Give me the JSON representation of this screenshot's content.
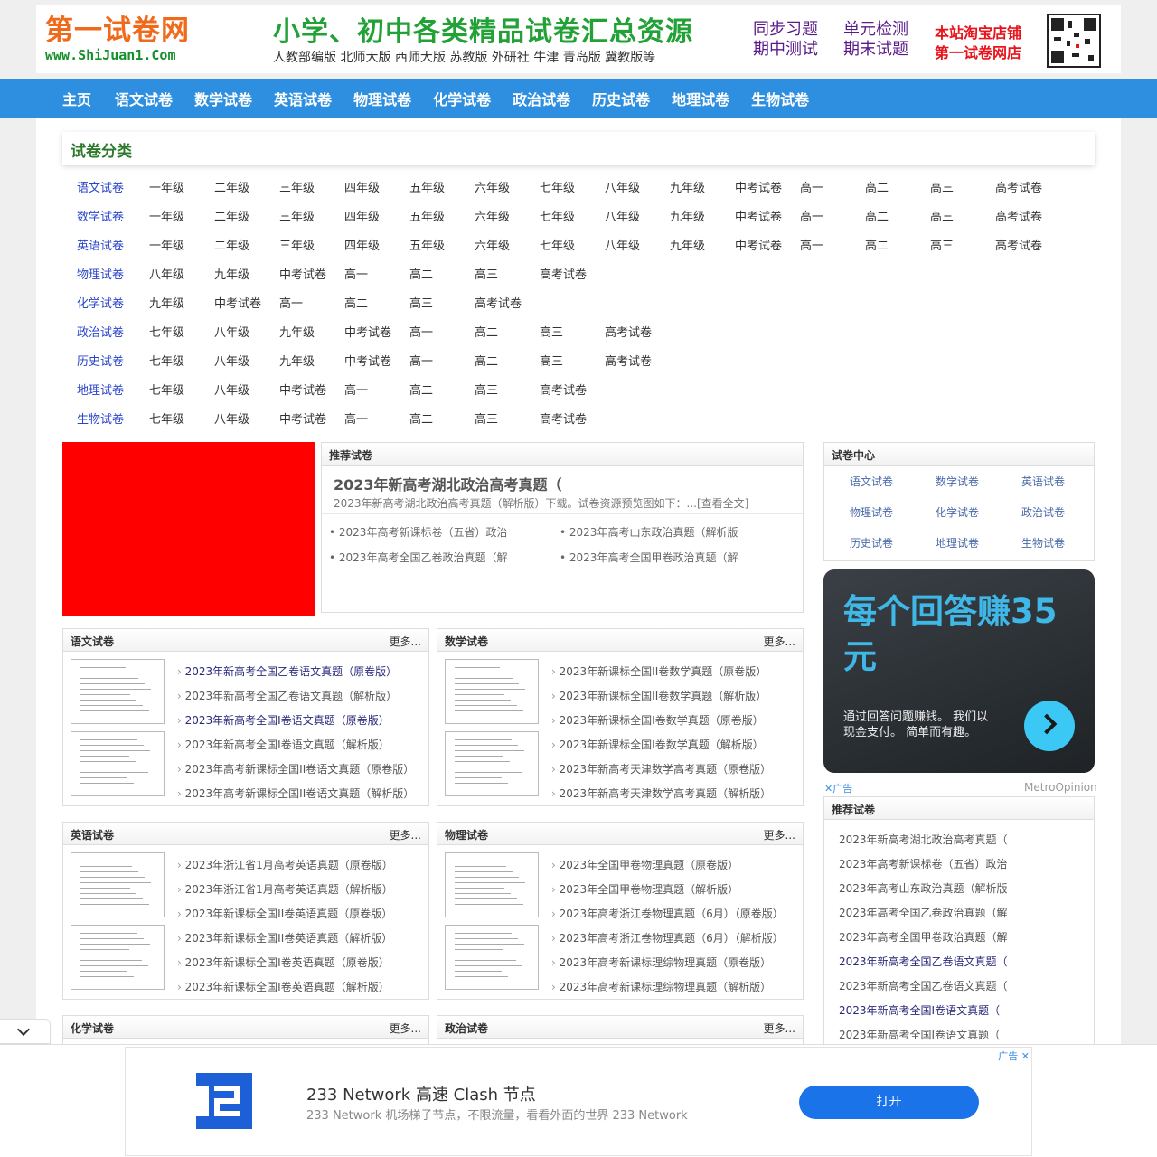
{
  "header": {
    "logo_cn": "第一试卷网",
    "logo_url": "www.ShiJuan1.Com",
    "slogan": "小学、初中各类精品试卷汇总资源",
    "slogan_sub": "人教部编版  北师大版  西师大版  苏教版  外研社  牛津  青岛版  冀教版等",
    "links": [
      "同步习题",
      "单元检测",
      "期中测试",
      "期末试题"
    ],
    "shop_line1": "本站淘宝店铺",
    "shop_line2": "第一试卷网店"
  },
  "nav": [
    "主页",
    "语文试卷",
    "数学试卷",
    "英语试卷",
    "物理试卷",
    "化学试卷",
    "政治试卷",
    "历史试卷",
    "地理试卷",
    "生物试卷"
  ],
  "categories": {
    "title": "试卷分类",
    "rows": [
      {
        "subject": "语文试卷",
        "grades": [
          "一年级",
          "二年级",
          "三年级",
          "四年级",
          "五年级",
          "六年级",
          "七年级",
          "八年级",
          "九年级",
          "中考试卷",
          "高一",
          "高二",
          "高三",
          "高考试卷"
        ]
      },
      {
        "subject": "数学试卷",
        "grades": [
          "一年级",
          "二年级",
          "三年级",
          "四年级",
          "五年级",
          "六年级",
          "七年级",
          "八年级",
          "九年级",
          "中考试卷",
          "高一",
          "高二",
          "高三",
          "高考试卷"
        ]
      },
      {
        "subject": "英语试卷",
        "grades": [
          "一年级",
          "二年级",
          "三年级",
          "四年级",
          "五年级",
          "六年级",
          "七年级",
          "八年级",
          "九年级",
          "中考试卷",
          "高一",
          "高二",
          "高三",
          "高考试卷"
        ]
      },
      {
        "subject": "物理试卷",
        "grades": [
          "八年级",
          "九年级",
          "中考试卷",
          "高一",
          "高二",
          "高三",
          "高考试卷"
        ]
      },
      {
        "subject": "化学试卷",
        "grades": [
          "九年级",
          "中考试卷",
          "高一",
          "高二",
          "高三",
          "高考试卷"
        ]
      },
      {
        "subject": "政治试卷",
        "grades": [
          "七年级",
          "八年级",
          "九年级",
          "中考试卷",
          "高一",
          "高二",
          "高三",
          "高考试卷"
        ]
      },
      {
        "subject": "历史试卷",
        "grades": [
          "七年级",
          "八年级",
          "九年级",
          "中考试卷",
          "高一",
          "高二",
          "高三",
          "高考试卷"
        ]
      },
      {
        "subject": "地理试卷",
        "grades": [
          "七年级",
          "八年级",
          "中考试卷",
          "高一",
          "高二",
          "高三",
          "高考试卷"
        ]
      },
      {
        "subject": "生物试卷",
        "grades": [
          "七年级",
          "八年级",
          "中考试卷",
          "高一",
          "高二",
          "高三",
          "高考试卷"
        ]
      }
    ]
  },
  "recommended": {
    "title": "推荐试卷",
    "headline": "2023年新高考湖北政治高考真题（",
    "desc": "2023年新高考湖北政治高考真题（解析版）下载。试卷资源预览图如下：...[查看全文]",
    "items": [
      "2023年高考新课标卷（五省）政治",
      "2023年高考山东政治真题（解析版",
      "2023年高考全国乙卷政治真题（解",
      "2023年高考全国甲卷政治真题（解"
    ]
  },
  "center": {
    "title": "试卷中心",
    "items": [
      "语文试卷",
      "数学试卷",
      "英语试卷",
      "物理试卷",
      "化学试卷",
      "政治试卷",
      "历史试卷",
      "地理试卷",
      "生物试卷"
    ]
  },
  "ad_card": {
    "headline": "每个回答赚35元",
    "text": "通过回答问题赚钱。 我们以现金支付。 简单而有趣。",
    "ad_label": "广告",
    "brand": "MetroOpinion"
  },
  "side_recommend": {
    "title": "推荐试卷",
    "items": [
      "2023年新高考湖北政治高考真题（",
      "2023年高考新课标卷（五省）政治",
      "2023年高考山东政治真题（解析版",
      "2023年高考全国乙卷政治真题（解",
      "2023年高考全国甲卷政治真题（解",
      "2023年新高考全国乙卷语文真题（",
      "2023年新高考全国乙卷语文真题（",
      "2023年新高考全国I卷语文真题（",
      "2023年新高考全国I卷语文真题（"
    ]
  },
  "boxes": [
    {
      "title": "语文试卷",
      "more": "更多...",
      "items": [
        "2023年新高考全国乙卷语文真题（原卷版）",
        "2023年新高考全国乙卷语文真题（解析版）",
        "2023年新高考全国I卷语文真题（原卷版）",
        "2023年新高考全国I卷语文真题（解析版）",
        "2023年高考新课标全国II卷语文真题（原卷版）",
        "2023年高考新课标全国II卷语文真题（解析版）"
      ]
    },
    {
      "title": "数学试卷",
      "more": "更多...",
      "items": [
        "2023年新课标全国II卷数学真题（原卷版）",
        "2023年新课标全国II卷数学真题（解析版）",
        "2023年新课标全国I卷数学真题（原卷版）",
        "2023年新课标全国I卷数学真题（解析版）",
        "2023年新高考天津数学高考真题（原卷版）",
        "2023年新高考天津数学高考真题（解析版）"
      ]
    },
    {
      "title": "英语试卷",
      "more": "更多...",
      "items": [
        "2023年浙江省1月高考英语真题（原卷版）",
        "2023年浙江省1月高考英语真题（解析版）",
        "2023年新课标全国II卷英语真题（原卷版）",
        "2023年新课标全国II卷英语真题（解析版）",
        "2023年新课标全国I卷英语真题（原卷版）",
        "2023年新课标全国I卷英语真题（解析版）"
      ]
    },
    {
      "title": "物理试卷",
      "more": "更多...",
      "items": [
        "2023年全国甲卷物理真题（原卷版）",
        "2023年全国甲卷物理真题（解析版）",
        "2023年高考浙江卷物理真题（6月）（原卷版）",
        "2023年高考浙江卷物理真题（6月）（解析版）",
        "2023年高考新课标理综物理真题（原卷版）",
        "2023年高考新课标理综物理真题（解析版）"
      ]
    },
    {
      "title": "化学试卷",
      "more": "更多...",
      "items": []
    },
    {
      "title": "政治试卷",
      "more": "更多...",
      "items": []
    }
  ],
  "bottom_ad": {
    "title": "233 Network 高速 Clash 节点",
    "desc": "233 Network 机场梯子节点，不限流量，看看外面的世界 233 Network",
    "button": "打开",
    "tag": "广告"
  }
}
